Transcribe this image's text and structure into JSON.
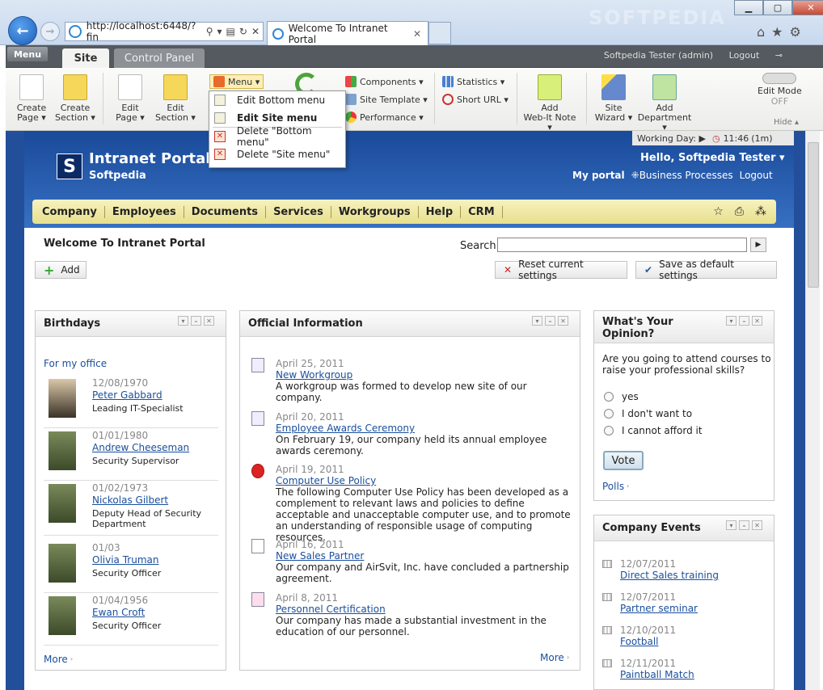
{
  "browser": {
    "url": "http://localhost:6448/?fin",
    "tab_title": "Welcome To Intranet Portal",
    "watermark": "SOFTPEDIA"
  },
  "admin": {
    "menu_label": "Menu",
    "tabs": [
      "Site",
      "Control Panel"
    ],
    "user": "Softpedia Tester (admin)",
    "logout": "Logout"
  },
  "ribbon": {
    "create_page": [
      "Create",
      "Page ▾"
    ],
    "create_section": [
      "Create",
      "Section ▾"
    ],
    "edit_page": [
      "Edit",
      "Page ▾"
    ],
    "edit_section": [
      "Edit",
      "Section ▾"
    ],
    "menu": "Menu ▾",
    "components": "Components ▾",
    "site_template": "Site Template ▾",
    "performance": "Performance ▾",
    "statistics": "Statistics ▾",
    "short_url": "Short URL ▾",
    "add_note": [
      "Add",
      "Web-It Note ▾"
    ],
    "site_wizard": [
      "Site",
      "Wizard ▾"
    ],
    "add_department": [
      "Add",
      "Department ▾"
    ],
    "edit_mode": "Edit Mode",
    "edit_mode_state": "OFF",
    "hide": "Hide ▴"
  },
  "dropdown": {
    "items": [
      "Edit Bottom menu",
      "Edit Site menu",
      "Delete \"Bottom menu\"",
      "Delete \"Site menu\""
    ]
  },
  "header": {
    "working_day": "Working Day: ▶",
    "time": "11:46",
    "time_elapsed": "(1m)",
    "title": "Intranet Portal",
    "subtitle": "Softpedia",
    "logo_letter": "S",
    "hello": "Hello, Softpedia Tester ▾",
    "my_portal": "My portal",
    "business_processes": "Business Processes",
    "logout": "Logout"
  },
  "topmenu": [
    "Company",
    "Employees",
    "Documents",
    "Services",
    "Workgroups",
    "Help",
    "CRM"
  ],
  "page": {
    "welcome": "Welcome To Intranet Portal",
    "search_label": "Search",
    "add": "Add",
    "reset": "Reset current settings",
    "save_default": "Save as default settings"
  },
  "birthdays": {
    "title": "Birthdays",
    "link": "For my office",
    "more": "More",
    "people": [
      {
        "date": "12/08/1970",
        "name": "Peter Gabbard",
        "position": "Leading IT-Specialist"
      },
      {
        "date": "01/01/1980",
        "name": "Andrew Cheeseman",
        "position": "Security Supervisor"
      },
      {
        "date": "01/02/1973",
        "name": "Nickolas Gilbert",
        "position": "Deputy Head of Security Department"
      },
      {
        "date": "01/03",
        "name": "Olivia Truman",
        "position": "Security Officer"
      },
      {
        "date": "01/04/1956",
        "name": "Ewan Croft",
        "position": "Security Officer"
      }
    ]
  },
  "official": {
    "title": "Official Information",
    "more": "More",
    "news": [
      {
        "date": "April 25, 2011",
        "title": "New Workgroup",
        "text": "A workgroup was formed to develop new site of our company."
      },
      {
        "date": "April 20, 2011",
        "title": "Employee Awards Ceremony",
        "text": "On February 19, our company held its annual employee awards ceremony."
      },
      {
        "date": "April 19, 2011",
        "title": "Computer Use Policy",
        "text": "The following Computer Use Policy has been developed as a complement to relevant laws and policies to define acceptable and unacceptable computer use, and to promote an understanding of responsible usage of computing resources."
      },
      {
        "date": "April 16, 2011",
        "title": "New Sales Partner",
        "text": "Our company and AirSvit, Inc. have concluded a partnership agreement."
      },
      {
        "date": "April 8, 2011",
        "title": "Personnel Certification",
        "text": "Our company has made a substantial investment in the education of our personnel."
      }
    ]
  },
  "poll": {
    "title": "What's Your Opinion?",
    "question": "Are you going to attend courses to raise your professional skills?",
    "options": [
      "yes",
      "I don't want to",
      "I cannot afford it"
    ],
    "vote": "Vote",
    "link": "Polls"
  },
  "events": {
    "title": "Company Events",
    "items": [
      {
        "date": "12/07/2011",
        "name": "Direct Sales training"
      },
      {
        "date": "12/07/2011",
        "name": "Partner seminar"
      },
      {
        "date": "12/10/2011",
        "name": "Football"
      },
      {
        "date": "12/11/2011",
        "name": "Paintball Match"
      }
    ]
  },
  "colors": {
    "accent": "#1a4f9c",
    "header": "#234e9a",
    "menubar": "#e8df8c"
  }
}
